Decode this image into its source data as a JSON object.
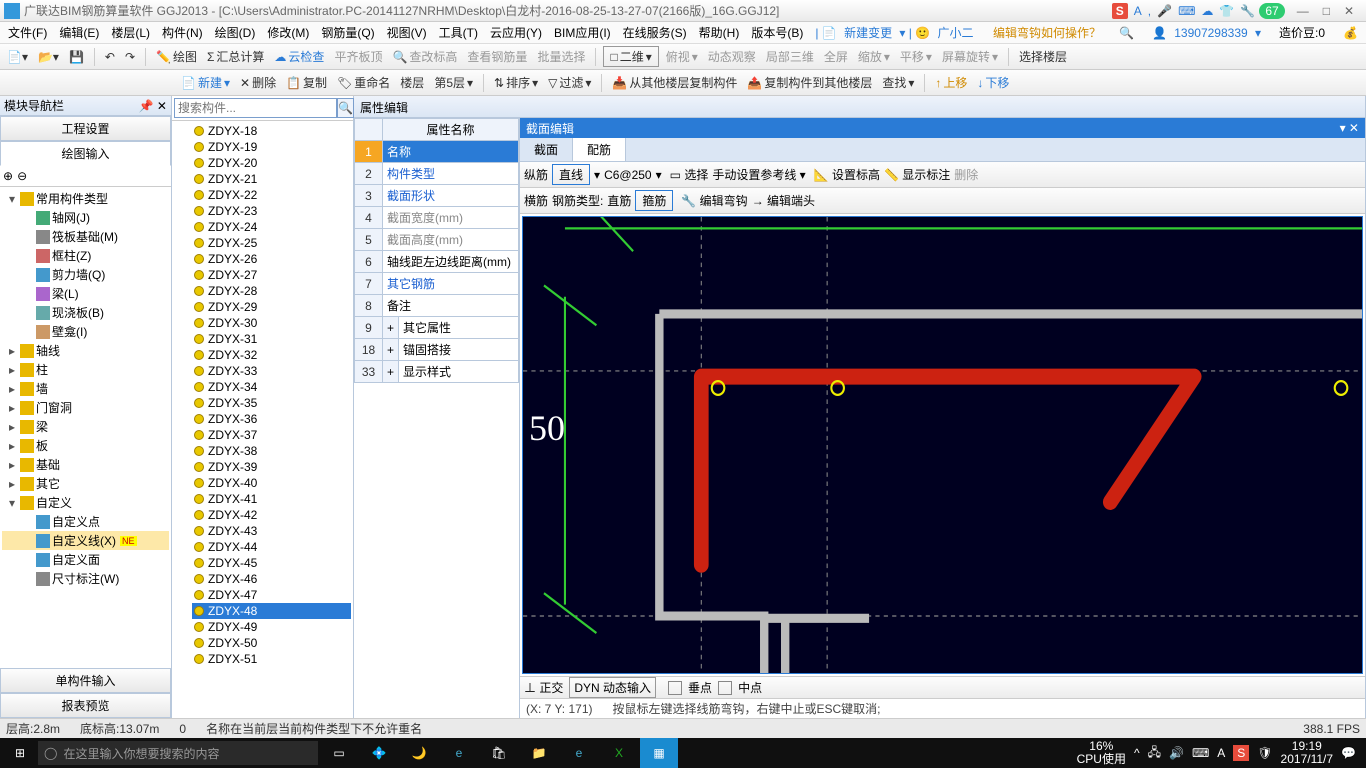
{
  "titlebar": {
    "text": "广联达BIM钢筋算量软件 GGJ2013 - [C:\\Users\\Administrator.PC-20141127NRHM\\Desktop\\白龙村-2016-08-25-13-27-07(2166版)_16G.GGJ12]",
    "badge": "67"
  },
  "menubar": {
    "items": [
      "文件(F)",
      "编辑(E)",
      "楼层(L)",
      "构件(N)",
      "绘图(D)",
      "修改(M)",
      "钢筋量(Q)",
      "视图(V)",
      "工具(T)",
      "云应用(Y)",
      "BIM应用(I)",
      "在线服务(S)",
      "帮助(H)",
      "版本号(B)"
    ],
    "newchange": "新建变更",
    "gxe": "广小二",
    "ask": "编辑弯钩如何操作？",
    "phone": "13907298339",
    "coin": "造价豆:0"
  },
  "toolbar1": {
    "items": [
      "绘图",
      "汇总计算",
      "云检查",
      "平齐板顶",
      "查改标高",
      "查看钢筋量",
      "批量选择"
    ],
    "view2d": "二维",
    "items2": [
      "俯视",
      "动态观察",
      "局部三维",
      "全屏",
      "缩放",
      "平移",
      "屏幕旋转",
      "选择楼层"
    ]
  },
  "toolbar2": {
    "new": "新建",
    "del": "删除",
    "copy": "复制",
    "rename": "重命名",
    "floor1": "楼层",
    "floor2": "第5层",
    "sort": "排序",
    "filter": "过滤",
    "copyfrom": "从其他楼层复制构件",
    "copyto": "复制构件到其他楼层",
    "find": "查找",
    "up": "上移",
    "down": "下移"
  },
  "leftpanel": {
    "title": "模块导航栏",
    "tab1": "工程设置",
    "tab2": "绘图输入",
    "tree": [
      {
        "indent": 0,
        "fold": "▾",
        "icon": "folder",
        "label": "常用构件类型"
      },
      {
        "indent": 1,
        "icon": "grid",
        "label": "轴网(J)"
      },
      {
        "indent": 1,
        "icon": "raft",
        "label": "筏板基础(M)"
      },
      {
        "indent": 1,
        "icon": "col",
        "label": "框柱(Z)"
      },
      {
        "indent": 1,
        "icon": "wall",
        "label": "剪力墙(Q)"
      },
      {
        "indent": 1,
        "icon": "beam",
        "label": "梁(L)"
      },
      {
        "indent": 1,
        "icon": "slab",
        "label": "现浇板(B)"
      },
      {
        "indent": 1,
        "icon": "niche",
        "label": "壁龛(I)"
      },
      {
        "indent": 0,
        "fold": "▸",
        "icon": "folder",
        "label": "轴线"
      },
      {
        "indent": 0,
        "fold": "▸",
        "icon": "folder",
        "label": "柱"
      },
      {
        "indent": 0,
        "fold": "▸",
        "icon": "folder",
        "label": "墙"
      },
      {
        "indent": 0,
        "fold": "▸",
        "icon": "folder",
        "label": "门窗洞"
      },
      {
        "indent": 0,
        "fold": "▸",
        "icon": "folder",
        "label": "梁"
      },
      {
        "indent": 0,
        "fold": "▸",
        "icon": "folder",
        "label": "板"
      },
      {
        "indent": 0,
        "fold": "▸",
        "icon": "folder",
        "label": "基础"
      },
      {
        "indent": 0,
        "fold": "▸",
        "icon": "folder",
        "label": "其它"
      },
      {
        "indent": 0,
        "fold": "▾",
        "icon": "folder",
        "label": "自定义"
      },
      {
        "indent": 1,
        "icon": "pt",
        "label": "自定义点"
      },
      {
        "indent": 1,
        "icon": "ln",
        "label": "自定义线(X)",
        "sel": true,
        "extra": "NE"
      },
      {
        "indent": 1,
        "icon": "ar",
        "label": "自定义面"
      },
      {
        "indent": 1,
        "icon": "dim",
        "label": "尺寸标注(W)"
      }
    ],
    "bottom1": "单构件输入",
    "bottom2": "报表预览"
  },
  "complist": {
    "placeholder": "搜索构件...",
    "items": [
      "ZDYX-18",
      "ZDYX-19",
      "ZDYX-20",
      "ZDYX-21",
      "ZDYX-22",
      "ZDYX-23",
      "ZDYX-24",
      "ZDYX-25",
      "ZDYX-26",
      "ZDYX-27",
      "ZDYX-28",
      "ZDYX-29",
      "ZDYX-30",
      "ZDYX-31",
      "ZDYX-32",
      "ZDYX-33",
      "ZDYX-34",
      "ZDYX-35",
      "ZDYX-36",
      "ZDYX-37",
      "ZDYX-38",
      "ZDYX-39",
      "ZDYX-40",
      "ZDYX-41",
      "ZDYX-42",
      "ZDYX-43",
      "ZDYX-44",
      "ZDYX-45",
      "ZDYX-46",
      "ZDYX-47",
      "ZDYX-48",
      "ZDYX-49",
      "ZDYX-50",
      "ZDYX-51"
    ],
    "selected": "ZDYX-48"
  },
  "properties": {
    "title": "属性编辑",
    "header": "属性名称",
    "rows": [
      {
        "n": "1",
        "name": "名称",
        "cls": "pn",
        "sel": true
      },
      {
        "n": "2",
        "name": "构件类型",
        "cls": "pn"
      },
      {
        "n": "3",
        "name": "截面形状",
        "cls": "pn"
      },
      {
        "n": "4",
        "name": "截面宽度(mm)",
        "cls": "pn gray"
      },
      {
        "n": "5",
        "name": "截面高度(mm)",
        "cls": "pn gray"
      },
      {
        "n": "6",
        "name": "轴线距左边线距离(mm)",
        "cls": ""
      },
      {
        "n": "7",
        "name": "其它钢筋",
        "cls": "pn"
      },
      {
        "n": "8",
        "name": "备注",
        "cls": ""
      },
      {
        "n": "9",
        "name": "其它属性",
        "cls": "",
        "exp": "+"
      },
      {
        "n": "18",
        "name": "锚固搭接",
        "cls": "",
        "exp": "+"
      },
      {
        "n": "33",
        "name": "显示样式",
        "cls": "",
        "exp": "+"
      }
    ]
  },
  "editor": {
    "title": "截面编辑",
    "tab1": "截面",
    "tab2": "配筋",
    "row1": {
      "label": "纵筋",
      "mode": "直线",
      "spec": "C6@250",
      "select": "选择",
      "manual": "手动设置参考线",
      "setelev": "设置标高",
      "showdim": "显示标注",
      "del": "删除"
    },
    "row2": {
      "label": "横筋",
      "typelabel": "钢筋类型:",
      "type1": "直筋",
      "type2": "箍筋",
      "edithook": "编辑弯钩",
      "editend": "编辑端头"
    },
    "dim": "50",
    "bottom": {
      "ortho": "正交",
      "dyn": "动态输入",
      "pt": "垂点",
      "mid": "中点"
    },
    "status": {
      "coords": "(X: 7 Y: 171)",
      "hint": "按鼠标左键选择线筋弯钩，右键中止或ESC键取消;"
    }
  },
  "statusbar": {
    "h": "层高:2.8m",
    "bh": "底标高:13.07m",
    "o": "0",
    "msg": "名称在当前层当前构件类型下不允许重名",
    "fps": "388.1 FPS"
  },
  "taskbar": {
    "search": "在这里输入你想要搜索的内容",
    "cpu": "16%",
    "cpulabel": "CPU使用",
    "time": "19:19",
    "date": "2017/11/7"
  }
}
